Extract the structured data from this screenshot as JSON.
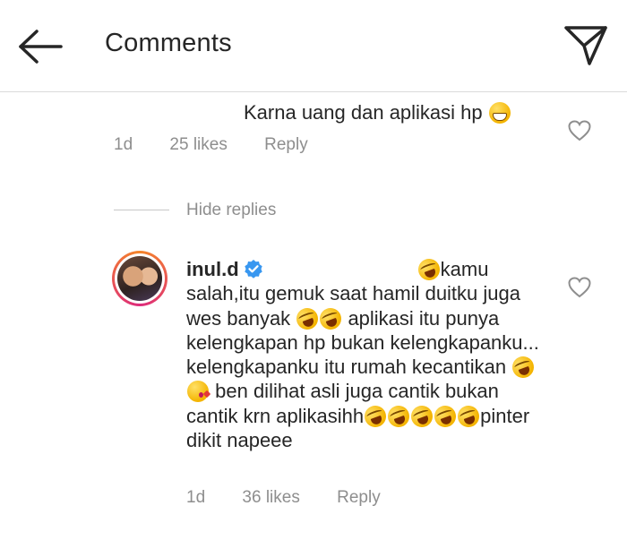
{
  "header": {
    "title": "Comments",
    "back_icon": "arrow-left-icon",
    "send_icon": "paper-plane-icon"
  },
  "comment1": {
    "text": "Karna uang dan aplikasi hp",
    "emoji": "grinning-face",
    "time": "1d",
    "likes": "25 likes",
    "reply": "Reply"
  },
  "replies": {
    "toggle": "Hide replies"
  },
  "comment2": {
    "username": "inul.d",
    "verified": true,
    "part1": "kamu salah,itu gemuk saat hamil duitku juga wes banyak",
    "part2": "aplikasi itu punya kelengkapan hp bukan kelengkapanku... kelengkapanku itu rumah kecantikan",
    "part3": "ben dilihat asli juga cantik bukan cantik krn aplikasihh",
    "part4": "pinter dikit napeee",
    "emojis": [
      "rolling-on-floor-laughing",
      "face-blowing-kiss"
    ],
    "time": "1d",
    "likes": "36 likes",
    "reply": "Reply"
  },
  "colors": {
    "text": "#262626",
    "muted": "#8e8e8e",
    "verified": "#3897f0",
    "divider": "#dbdbdb"
  }
}
